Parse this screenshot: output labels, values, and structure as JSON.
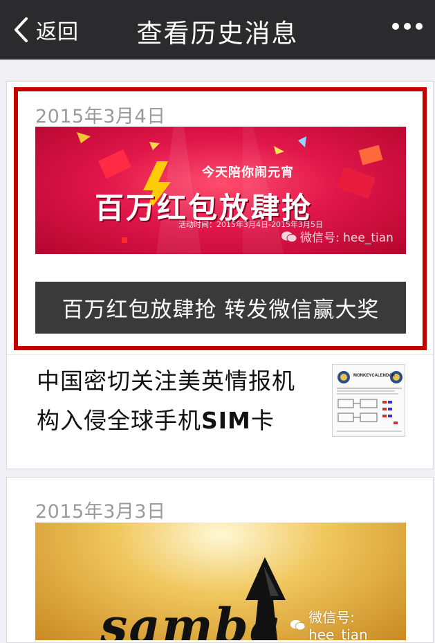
{
  "nav": {
    "back_label": "返回",
    "title": "查看历史消息"
  },
  "card1": {
    "date": "2015年3月4日",
    "banner": {
      "tagline": "今天陪你闹元宵",
      "headline": "百万红包放肆抢",
      "activity_time": "活动时间：2015年3月4日-2015年3月5日",
      "watermark": "微信号: hee_tian"
    },
    "caption": "百万红包放肆抢 转发微信赢大奖",
    "article": {
      "line1": "中国密切关注美英情报机",
      "line2_prefix": "构入侵全球手机",
      "line2_sim": "SIM",
      "line2_suffix": "卡"
    },
    "thumb_title": "MONKEYCALENDAR"
  },
  "card2": {
    "date": "2015年3月3日",
    "banner_text": "samba",
    "watermark": "微信号: hee_tian"
  },
  "colors": {
    "highlight_border": "#c40000",
    "navbar": "#2b2b2d",
    "caption_bg": "#3a3a3a"
  }
}
